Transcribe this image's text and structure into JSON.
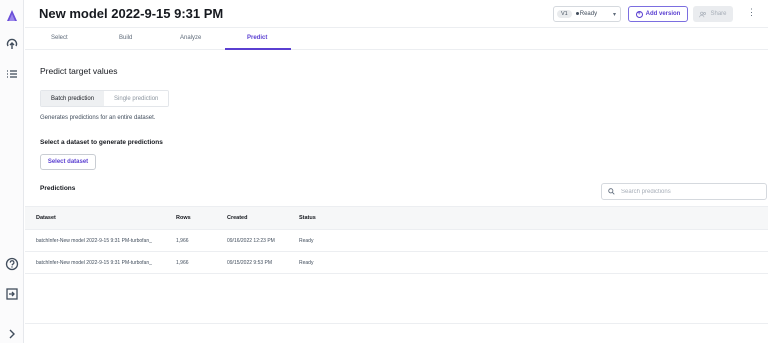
{
  "header": {
    "title": "New model 2022-9-15 9:31 PM",
    "version_badge": "V1",
    "version_status": "Ready",
    "add_version_label": "Add version",
    "share_label": "Share"
  },
  "tabs": [
    {
      "label": "Select",
      "active": false
    },
    {
      "label": "Build",
      "active": false
    },
    {
      "label": "Analyze",
      "active": false
    },
    {
      "label": "Predict",
      "active": true
    }
  ],
  "main": {
    "section_title": "Predict target values",
    "mode_tabs": [
      {
        "label": "Batch prediction",
        "active": true
      },
      {
        "label": "Single prediction",
        "active": false
      }
    ],
    "description": "Generates predictions for an entire dataset.",
    "select_heading": "Select a dataset to generate predictions",
    "select_button_label": "Select dataset",
    "predictions_heading": "Predictions",
    "search_placeholder": "Search predictions"
  },
  "table": {
    "columns": [
      "Dataset",
      "Rows",
      "Created",
      "Status"
    ],
    "rows": [
      {
        "dataset": "batchInfer-New model 2022-9-15 9:31 PM-turbofan_",
        "rows": "1,966",
        "created": "09/16/2022 12:23 PM",
        "status": "Ready"
      },
      {
        "dataset": "batchInfer-New model 2022-9-15 9:31 PM-turbofan_",
        "rows": "1,966",
        "created": "09/15/2022 9:53 PM",
        "status": "Ready"
      }
    ]
  },
  "sidebar": {
    "icons": [
      "logo-icon",
      "deploy-icon",
      "list-icon",
      "help-icon",
      "sign-out-icon",
      "expand-icon"
    ]
  },
  "colors": {
    "accent": "#5a3fd1",
    "text": "#16191f",
    "muted": "#5f6b7a",
    "border": "#eceef1"
  }
}
